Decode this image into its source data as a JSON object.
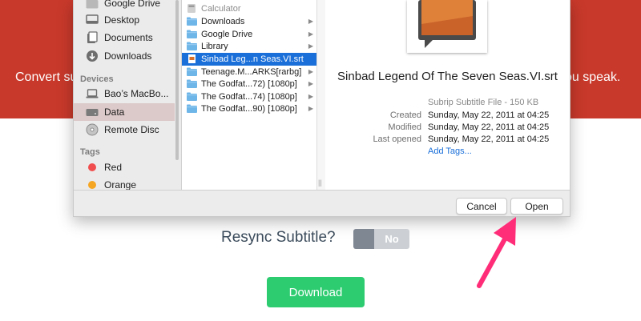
{
  "hero": {
    "text_left": "Convert su",
    "text_right": "ou speak."
  },
  "dialog": {
    "sidebar": {
      "favorites": [
        {
          "label": "Google Drive",
          "icon": "drive-folder-icon"
        },
        {
          "label": "Desktop",
          "icon": "desktop-icon"
        },
        {
          "label": "Documents",
          "icon": "documents-icon"
        },
        {
          "label": "Downloads",
          "icon": "downloads-icon"
        }
      ],
      "devices_header": "Devices",
      "devices": [
        {
          "label": "Bao’s MacBo...",
          "icon": "laptop-icon"
        },
        {
          "label": "Data",
          "icon": "disk-icon",
          "selected": true
        },
        {
          "label": "Remote Disc",
          "icon": "disc-icon"
        }
      ],
      "tags_header": "Tags",
      "tags": [
        {
          "label": "Red",
          "color": "#f04e4e"
        },
        {
          "label": "Orange",
          "color": "#f5a623"
        }
      ]
    },
    "files": [
      {
        "label": "Calculator",
        "type": "app",
        "has_arrow": false,
        "muted": true
      },
      {
        "label": "Downloads",
        "type": "folder",
        "has_arrow": true
      },
      {
        "label": "Google Drive",
        "type": "folder",
        "has_arrow": true
      },
      {
        "label": "Library",
        "type": "folder",
        "has_arrow": true
      },
      {
        "label": "Sinbad Leg...n Seas.VI.srt",
        "type": "file",
        "has_arrow": false,
        "selected": true
      },
      {
        "label": "Teenage.M...ARKS[rarbg]",
        "type": "folder",
        "has_arrow": true
      },
      {
        "label": "The Godfat...72) [1080p]",
        "type": "folder",
        "has_arrow": true
      },
      {
        "label": "The Godfat...74) [1080p]",
        "type": "folder",
        "has_arrow": true
      },
      {
        "label": "The Godfat...90) [1080p]",
        "type": "folder",
        "has_arrow": true
      }
    ],
    "preview": {
      "filename": "Sinbad Legend Of The Seven Seas.VI.srt",
      "kind": "Subrip Subtitle File - 150 KB",
      "created_label": "Created",
      "created": "Sunday, May 22, 2011 at 04:25",
      "modified_label": "Modified",
      "modified": "Sunday, May 22, 2011 at 04:25",
      "opened_label": "Last opened",
      "opened": "Sunday, May 22, 2011 at 04:25",
      "add_tags": "Add Tags..."
    },
    "cancel_label": "Cancel",
    "open_label": "Open",
    "grabber": "||"
  },
  "page": {
    "resync_label": "Resync Subtitle?",
    "toggle_label": "No",
    "download_label": "Download"
  },
  "colors": {
    "hero": "#c8392b",
    "selection": "#1a6fd9",
    "download": "#2ecc71",
    "arrow": "#ff2d78"
  }
}
